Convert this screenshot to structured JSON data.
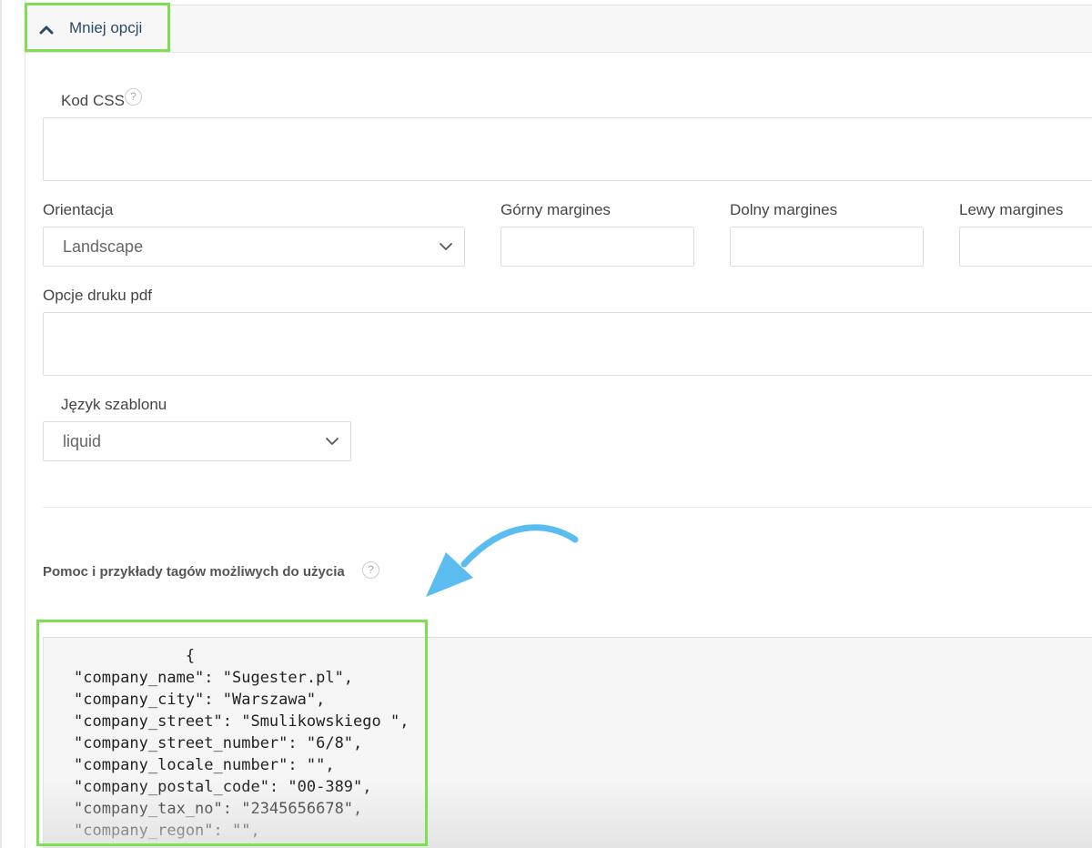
{
  "toggle": {
    "label": "Mniej opcji",
    "icon": "chevron-up-icon"
  },
  "css_code": {
    "label": "Kod CSS",
    "help": "?",
    "value": ""
  },
  "orientation": {
    "label": "Orientacja",
    "value": "Landscape"
  },
  "margins": {
    "top_label": "Górny margines",
    "top_value": "",
    "bottom_label": "Dolny margines",
    "bottom_value": "",
    "left_label": "Lewy margines",
    "left_value": ""
  },
  "pdf_options": {
    "label": "Opcje druku pdf",
    "value": ""
  },
  "template_language": {
    "label": "Język szablonu",
    "value": "liquid"
  },
  "help_section": {
    "title": "Pomoc i przykłady tagów możliwych do użycia",
    "help": "?"
  },
  "code_lines": [
    "            {",
    "\"company_name\": \"Sugester.pl\",",
    "\"company_city\": \"Warszawa\",",
    "\"company_street\": \"Smulikowskiego \",",
    "\"company_street_number\": \"6/8\",",
    "\"company_locale_number\": \"\",",
    "\"company_postal_code\": \"00-389\",",
    "\"company_tax_no\": \"2345656678\",",
    "\"company_regon\": \"\","
  ],
  "colors": {
    "highlight": "#7de052",
    "arrow": "#5bbcf0",
    "link": "#2c4a66"
  }
}
